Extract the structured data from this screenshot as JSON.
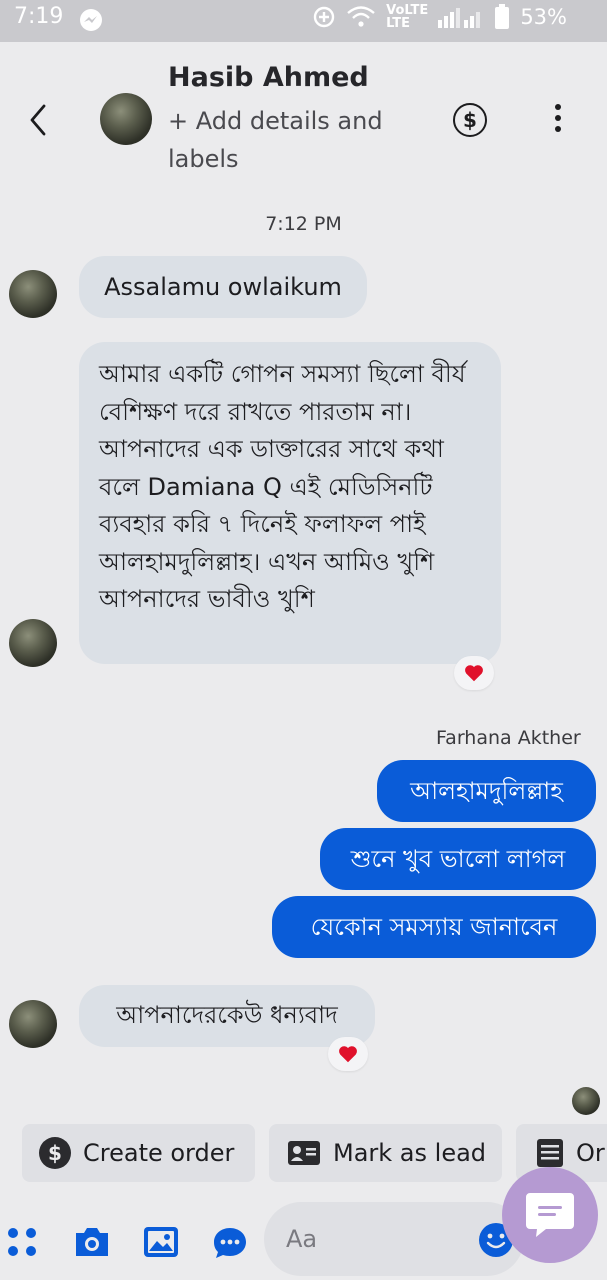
{
  "status_bar": {
    "time": "7:19",
    "battery": "53%",
    "network": "VoLTE",
    "network_sub": "LTE"
  },
  "header": {
    "name": "Hasib Ahmed",
    "subtitle": "+ Add details and labels"
  },
  "timestamp": "7:12 PM",
  "messages": [
    {
      "direction": "in",
      "text": "Assalamu owlaikum"
    },
    {
      "direction": "in",
      "text": "আমার একটি গোপন সমস্যা ছিলো বীর্য বেশিক্ষণ দরে রাখতে পারতাম না। আপনাদের এক ডাক্তারের সাথে কথা বলে Damiana Q এই মেডিসিনটি ব্যবহার করি ৭ দিনেই ফলাফল পাই আলহামদুলিল্লাহ। এখন আমিও খুশি আপনাদের ভাবীও খুশি",
      "reaction": "heart"
    },
    {
      "direction": "out",
      "sender": "Farhana Akther",
      "text": "আলহামদুলিল্লাহ"
    },
    {
      "direction": "out",
      "text": "শুনে খুব ভালো লাগল"
    },
    {
      "direction": "out",
      "text": "যেকোন সমস্যায় জানাবেন"
    },
    {
      "direction": "in",
      "text": "আপনাদেরকেউ ধন্যবাদ",
      "reaction": "heart"
    }
  ],
  "quick_actions": [
    {
      "label": "Create order",
      "icon": "dollar-icon"
    },
    {
      "label": "Mark as lead",
      "icon": "contact-card-icon"
    },
    {
      "label": "Or",
      "icon": "list-icon"
    }
  ],
  "composer": {
    "placeholder": "Aa"
  },
  "colors": {
    "accent": "#0a5cd8",
    "incoming_bubble": "#dbe0e6",
    "background": "#ebebed",
    "heart": "#e0112b",
    "chat_fab": "#b59ad2"
  }
}
